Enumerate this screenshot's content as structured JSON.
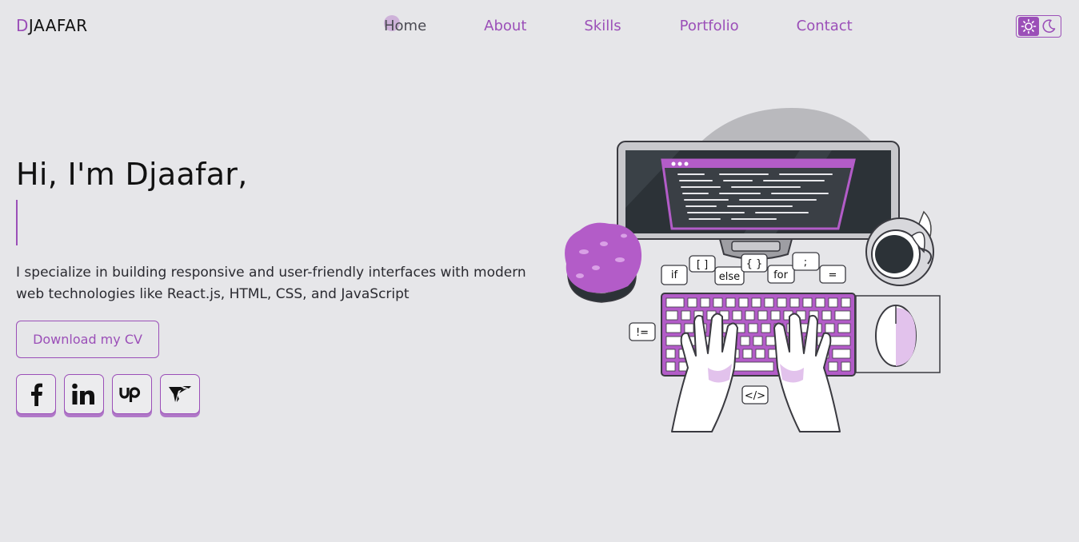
{
  "brand": {
    "logo_first": "D",
    "logo_rest": "JAAFAR"
  },
  "nav": {
    "items": [
      {
        "label": "Home"
      },
      {
        "label": "About"
      },
      {
        "label": "Skills"
      },
      {
        "label": "Portfolio"
      },
      {
        "label": "Contact"
      }
    ]
  },
  "theme_toggle": {
    "icons": [
      "sun-icon",
      "moon-icon"
    ],
    "active": "light"
  },
  "hero": {
    "title": "Hi, I'm Djaafar,",
    "description": "I specialize in building responsive and user-friendly interfaces with modern web technologies like React.js, HTML, CSS, and JavaScript",
    "cv_button": "Download my CV"
  },
  "socials": [
    {
      "icon": "facebook-icon"
    },
    {
      "icon": "linkedin-icon"
    },
    {
      "icon": "upwork-icon"
    },
    {
      "icon": "freelancer-icon"
    }
  ],
  "illustration": {
    "code_bubbles": [
      "if",
      "[ ]",
      "else",
      "{ }",
      "for",
      ";",
      "=",
      "!=",
      "</>"
    ]
  },
  "colors": {
    "accent": "#9b4fb8",
    "background": "#e6e6e9",
    "text": "#1e1e24"
  }
}
